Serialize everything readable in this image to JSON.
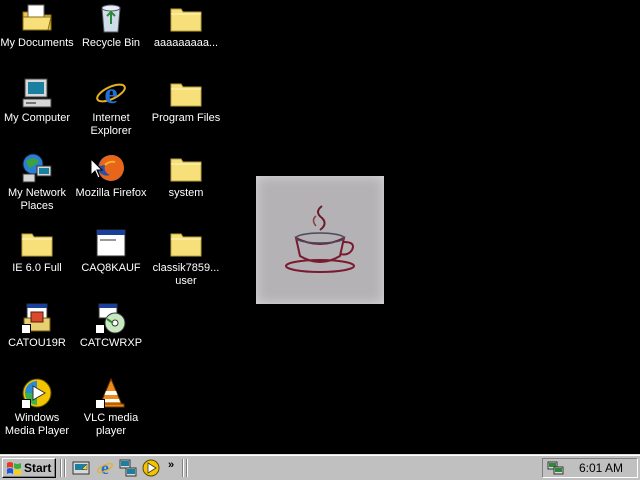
{
  "desktop": {
    "icons": [
      {
        "label": "My Documents",
        "icon": "my-documents-icon"
      },
      {
        "label": "Recycle Bin",
        "icon": "recycle-bin-icon"
      },
      {
        "label": "aaaaaaaaa...",
        "icon": "folder-icon"
      },
      {
        "label": "My Computer",
        "icon": "my-computer-icon"
      },
      {
        "label": "Internet\nExplorer",
        "icon": "internet-explorer-icon"
      },
      {
        "label": "Program Files",
        "icon": "folder-icon"
      },
      {
        "label": "My Network\nPlaces",
        "icon": "network-places-icon"
      },
      {
        "label": "Mozilla Firefox",
        "icon": "firefox-icon"
      },
      {
        "label": "system",
        "icon": "folder-icon"
      },
      {
        "label": "IE 6.0 Full",
        "icon": "folder-icon"
      },
      {
        "label": "CAQ8KAUF",
        "icon": "window-icon"
      },
      {
        "label": "classik7859...\nuser",
        "icon": "folder-icon"
      },
      {
        "label": "CATOU19R",
        "icon": "installer-icon"
      },
      {
        "label": "CATCWRXP",
        "icon": "cd-installer-icon"
      },
      {
        "label": "Windows\nMedia Player",
        "icon": "media-player-icon"
      },
      {
        "label": "VLC media\nplayer",
        "icon": "vlc-icon"
      }
    ]
  },
  "taskbar": {
    "start_label": "Start",
    "chevron": "»",
    "clock": "6:01 AM"
  },
  "colors": {
    "desktop_bg": "#000000",
    "taskbar_bg": "#c0c0c0",
    "folder_yellow": "#f7e07a"
  }
}
